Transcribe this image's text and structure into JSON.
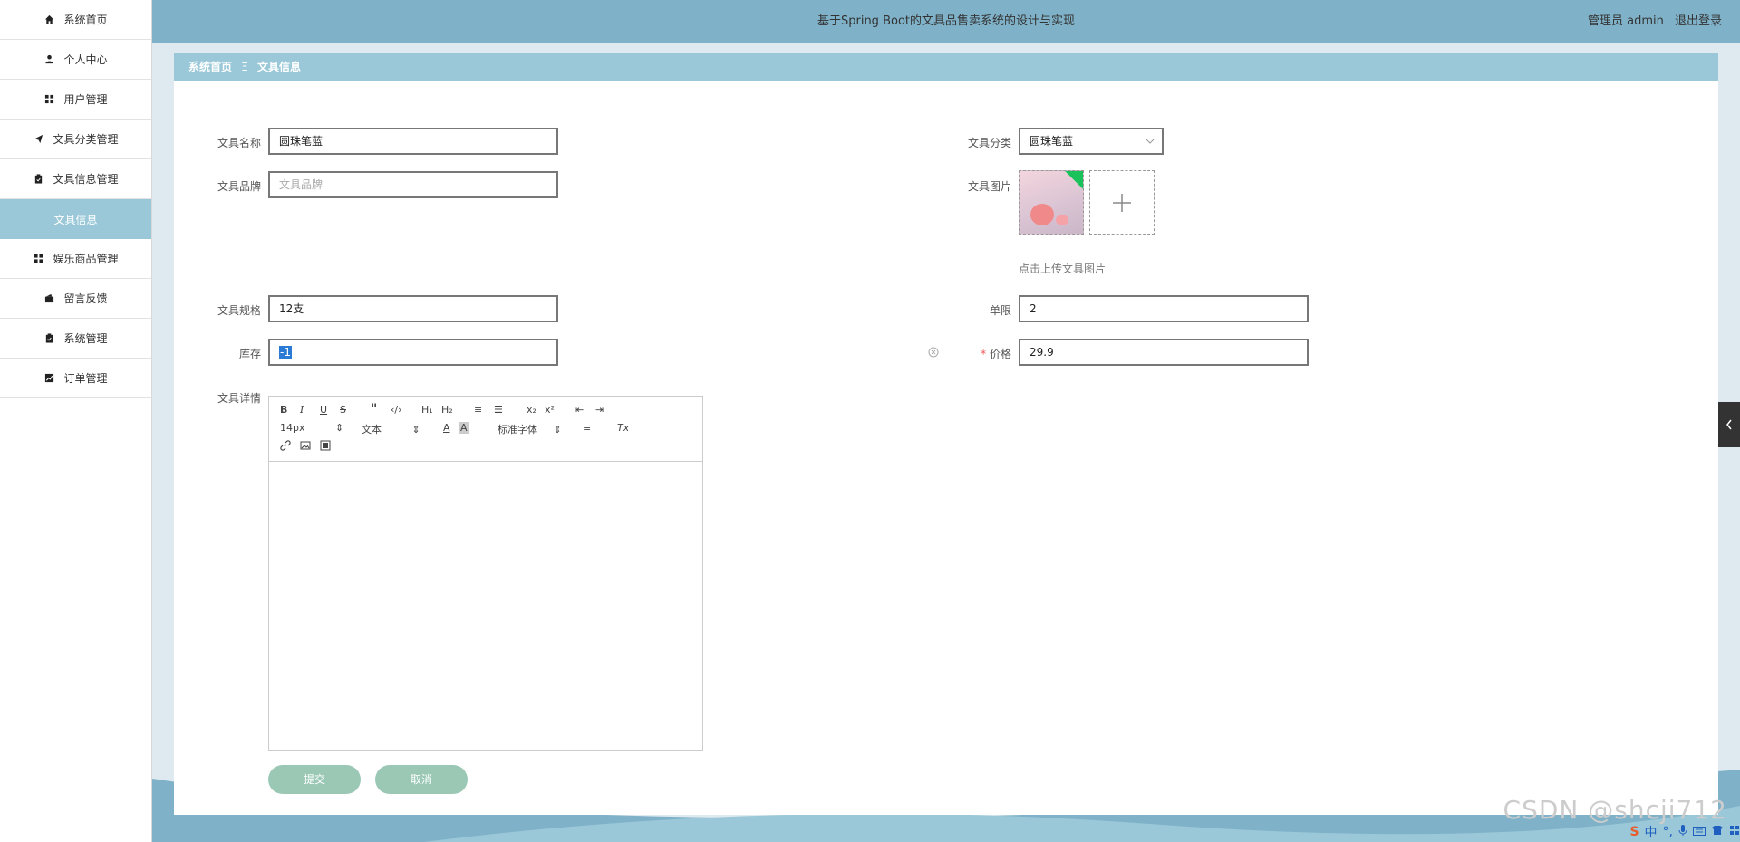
{
  "app": {
    "title": "基于Spring Boot的文具品售卖系统的设计与实现",
    "user_label": "管理员 admin",
    "logout": "退出登录"
  },
  "sidebar": {
    "items": [
      {
        "label": "系统首页",
        "icon": "home-icon"
      },
      {
        "label": "个人中心",
        "icon": "person-icon"
      },
      {
        "label": "用户管理",
        "icon": "grid-icon"
      },
      {
        "label": "文具分类管理",
        "icon": "paper-plane-icon"
      },
      {
        "label": "文具信息管理",
        "icon": "clipboard-icon"
      },
      {
        "label": "文具信息",
        "icon": ""
      },
      {
        "label": "娱乐商品管理",
        "icon": "grid-icon"
      },
      {
        "label": "留言反馈",
        "icon": "wallet-icon"
      },
      {
        "label": "系统管理",
        "icon": "clipboard-icon"
      },
      {
        "label": "订单管理",
        "icon": "chart-icon"
      }
    ]
  },
  "breadcrumb": {
    "home": "系统首页",
    "separator": "Ξ",
    "current": "文具信息"
  },
  "form": {
    "name_label": "文具名称",
    "name_value": "圆珠笔蓝",
    "category_label": "文具分类",
    "category_value": "圆珠笔蓝",
    "brand_label": "文具品牌",
    "brand_placeholder": "文具品牌",
    "image_label": "文具图片",
    "image_hint": "点击上传文具图片",
    "spec_label": "文具规格",
    "spec_value": "12支",
    "limit_label": "单限",
    "limit_value": "2",
    "stock_label": "库存",
    "stock_value": "-1",
    "price_required": "*",
    "price_label": "价格",
    "price_value": "29.9",
    "detail_label": "文具详情"
  },
  "editor": {
    "font_size": "14px",
    "text_style": "文本",
    "font_family": "标准字体"
  },
  "buttons": {
    "submit": "提交",
    "cancel": "取消"
  },
  "watermark": "CSDN @shcji712",
  "ime": {
    "label": "中"
  },
  "colors": {
    "header": "#7fb2c9",
    "breadcrumb": "#9ac8d8",
    "button": "#9ac8b5",
    "sidebar_active": "#9ac8d8"
  }
}
